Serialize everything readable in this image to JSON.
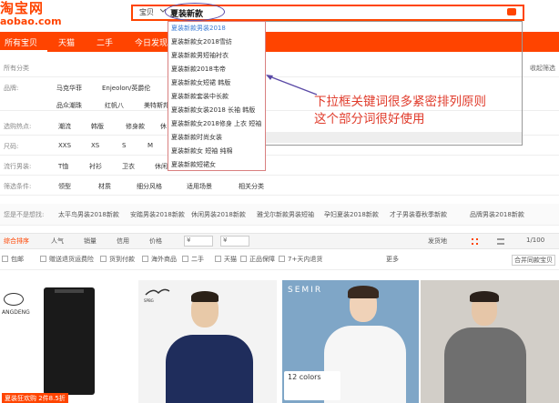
{
  "header": {
    "logo_main": "淘宝网",
    "logo_sub": "aobao.com",
    "search_category": "宝贝",
    "search_value": "夏装新款"
  },
  "tabs": [
    "所有宝贝",
    "天猫",
    "二手",
    "今日发现"
  ],
  "dropdown": {
    "items": [
      "夏装新款男装2018",
      "夏装新款女2018雪纺",
      "夏装新款男短袖衬衣",
      "夏装新款2018韦帝",
      "夏装新款女短裙 韩版",
      "夏装新款套装中长款",
      "夏装新款女装2018 长袖 韩版",
      "夏装新款女2018修身 上衣 短袖",
      "夏装新款时尚女装",
      "夏装新款女 短袖 纯棉",
      "夏装新款短裙女"
    ]
  },
  "annotation": {
    "line1": "下拉框关键词很多紧密排列原则",
    "line2": "这个部分词很好使用"
  },
  "filters": {
    "all_category": "所有分类",
    "collapse_label": "收起筛选",
    "rows": [
      {
        "label": "品牌:",
        "options": [
          "马克华菲",
          "Enjeolon/英爵伦"
        ]
      },
      {
        "label": "",
        "options": [
          "品众潮珠",
          "红帆八",
          "美特斯邦"
        ]
      },
      {
        "label": "选购热点:",
        "options": [
          "潮流",
          "韩版",
          "修身款",
          "休"
        ]
      },
      {
        "label": "尺码:",
        "options": [
          "XXS",
          "XS",
          "S",
          "M"
        ]
      },
      {
        "label": "流行男装:",
        "options": [
          "T恤",
          "衬衫",
          "卫衣",
          "休闲"
        ]
      },
      {
        "label": "筛选条件:",
        "options": [
          "领型",
          "材质",
          "细分风格",
          "适用场景",
          "相关分类"
        ]
      }
    ],
    "related_label": "您是不是想找:",
    "related": [
      "太平鸟男装2018新款",
      "安踏男装2018新款",
      "休闲男装2018新款",
      "雅戈尔新款男装短袖",
      "孕妇夏装2018新款",
      "才子男装春秋季新款",
      "品牌男装2018新款"
    ]
  },
  "sortbar": {
    "items": [
      "综合排序",
      "人气",
      "销量",
      "信用",
      "价格"
    ],
    "price_from": "¥",
    "price_to": "¥",
    "ship": "发货地",
    "page": "1/100"
  },
  "checks": [
    "包邮",
    "赠送退货运费险",
    "货到付款",
    "海外商品",
    "二手",
    "天猫",
    "正品保障",
    "7+天内退货",
    "更多",
    "合并同款宝贝"
  ],
  "products": [
    {
      "brand": "ANGDENG",
      "promo": "夏装狂欢购 2件8.5折"
    },
    {
      "brand": "SPBG",
      "promo": ""
    },
    {
      "brand": "SEMIR",
      "promo": "12 colors"
    },
    {
      "brand": "",
      "promo": ""
    }
  ]
}
